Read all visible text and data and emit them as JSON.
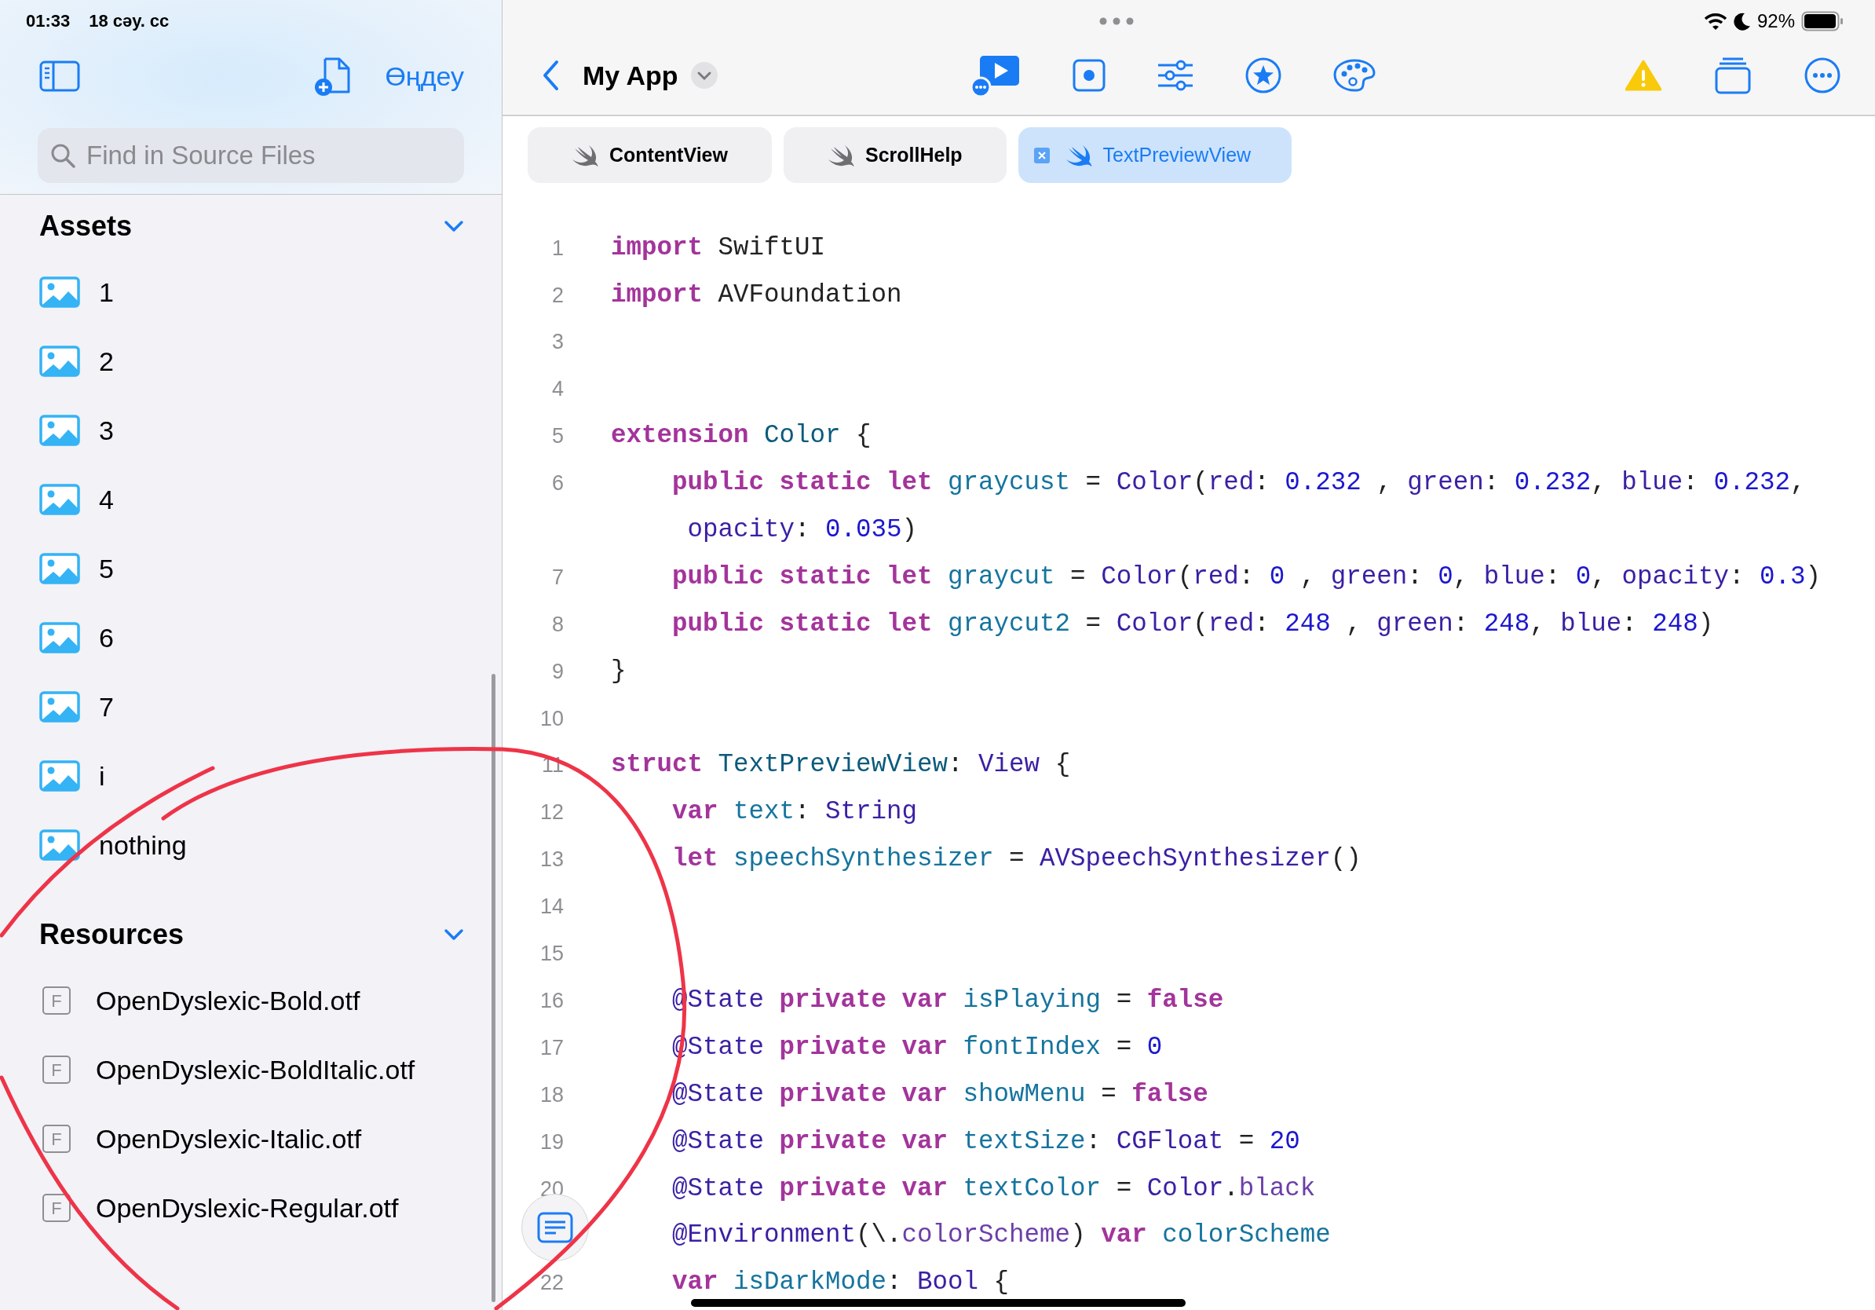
{
  "status_bar": {
    "time": "01:33",
    "date": "18 сәу. сс",
    "battery": "92%"
  },
  "sidebar": {
    "edit_button": "Өңдеу",
    "search": {
      "placeholder": "Find in Source Files"
    },
    "sections": [
      {
        "title": "Assets",
        "expanded": true,
        "items": [
          {
            "kind": "image",
            "label": "1"
          },
          {
            "kind": "image",
            "label": "2"
          },
          {
            "kind": "image",
            "label": "3"
          },
          {
            "kind": "image",
            "label": "4"
          },
          {
            "kind": "image",
            "label": "5"
          },
          {
            "kind": "image",
            "label": "6"
          },
          {
            "kind": "image",
            "label": "7"
          },
          {
            "kind": "image",
            "label": "i"
          },
          {
            "kind": "image",
            "label": "nothing"
          }
        ]
      },
      {
        "title": "Resources",
        "expanded": true,
        "items": [
          {
            "kind": "font",
            "label": "OpenDyslexic-Bold.otf",
            "badge": "F"
          },
          {
            "kind": "font",
            "label": "OpenDyslexic-BoldItalic.otf",
            "badge": "F"
          },
          {
            "kind": "font",
            "label": "OpenDyslexic-Italic.otf",
            "badge": "F"
          },
          {
            "kind": "font",
            "label": "OpenDyslexic-Regular.otf",
            "badge": "F"
          }
        ]
      }
    ]
  },
  "toolbar": {
    "title": "My App"
  },
  "tabs": [
    {
      "label": "ContentView",
      "selected": false
    },
    {
      "label": "ScrollHelp",
      "selected": false
    },
    {
      "label": "TextPreviewView",
      "selected": true
    }
  ],
  "code": {
    "lines": [
      {
        "number": "1",
        "tokens": [
          {
            "kind": "kw",
            "text": "import"
          },
          {
            "kind": "pl",
            "text": " SwiftUI"
          }
        ]
      },
      {
        "number": "2",
        "tokens": [
          {
            "kind": "kw",
            "text": "import"
          },
          {
            "kind": "pl",
            "text": " AVFoundation"
          }
        ]
      },
      {
        "number": "3"
      },
      {
        "number": "4"
      },
      {
        "number": "5",
        "tokens": [
          {
            "kind": "kw",
            "text": "extension"
          },
          {
            "kind": "decl",
            "text": " Color"
          },
          {
            "kind": "pl",
            "text": " {"
          }
        ]
      },
      {
        "number": "6",
        "tokens": [
          {
            "kind": "kw",
            "text": "    public static let"
          },
          {
            "kind": "id",
            "text": " graycust"
          },
          {
            "kind": "pl",
            "text": " = "
          },
          {
            "kind": "type",
            "text": "Color"
          },
          {
            "kind": "pl",
            "text": "("
          },
          {
            "kind": "type",
            "text": "red"
          },
          {
            "kind": "pl",
            "text": ": "
          },
          {
            "kind": "num",
            "text": "0.232"
          },
          {
            "kind": "pl",
            "text": " , "
          },
          {
            "kind": "type",
            "text": "green"
          },
          {
            "kind": "pl",
            "text": ": "
          },
          {
            "kind": "num",
            "text": "0.232"
          },
          {
            "kind": "pl",
            "text": ", "
          },
          {
            "kind": "type",
            "text": "blue"
          },
          {
            "kind": "pl",
            "text": ": "
          },
          {
            "kind": "num",
            "text": "0.232"
          },
          {
            "kind": "pl",
            "text": ","
          }
        ]
      },
      {
        "tokens": [
          {
            "kind": "type",
            "text": "     opacity"
          },
          {
            "kind": "pl",
            "text": ": "
          },
          {
            "kind": "num",
            "text": "0.035"
          },
          {
            "kind": "pl",
            "text": ")"
          }
        ]
      },
      {
        "number": "7",
        "tokens": [
          {
            "kind": "kw",
            "text": "    public static let"
          },
          {
            "kind": "id",
            "text": " graycut"
          },
          {
            "kind": "pl",
            "text": " = "
          },
          {
            "kind": "type",
            "text": "Color"
          },
          {
            "kind": "pl",
            "text": "("
          },
          {
            "kind": "type",
            "text": "red"
          },
          {
            "kind": "pl",
            "text": ": "
          },
          {
            "kind": "num",
            "text": "0"
          },
          {
            "kind": "pl",
            "text": " , "
          },
          {
            "kind": "type",
            "text": "green"
          },
          {
            "kind": "pl",
            "text": ": "
          },
          {
            "kind": "num",
            "text": "0"
          },
          {
            "kind": "pl",
            "text": ", "
          },
          {
            "kind": "type",
            "text": "blue"
          },
          {
            "kind": "pl",
            "text": ": "
          },
          {
            "kind": "num",
            "text": "0"
          },
          {
            "kind": "pl",
            "text": ", "
          },
          {
            "kind": "type",
            "text": "opacity"
          },
          {
            "kind": "pl",
            "text": ": "
          },
          {
            "kind": "num",
            "text": "0.3"
          },
          {
            "kind": "pl",
            "text": ")"
          }
        ]
      },
      {
        "number": "8",
        "tokens": [
          {
            "kind": "kw",
            "text": "    public static let"
          },
          {
            "kind": "id",
            "text": " graycut2"
          },
          {
            "kind": "pl",
            "text": " = "
          },
          {
            "kind": "type",
            "text": "Color"
          },
          {
            "kind": "pl",
            "text": "("
          },
          {
            "kind": "type",
            "text": "red"
          },
          {
            "kind": "pl",
            "text": ": "
          },
          {
            "kind": "num",
            "text": "248"
          },
          {
            "kind": "pl",
            "text": " , "
          },
          {
            "kind": "type",
            "text": "green"
          },
          {
            "kind": "pl",
            "text": ": "
          },
          {
            "kind": "num",
            "text": "248"
          },
          {
            "kind": "pl",
            "text": ", "
          },
          {
            "kind": "type",
            "text": "blue"
          },
          {
            "kind": "pl",
            "text": ": "
          },
          {
            "kind": "num",
            "text": "248"
          },
          {
            "kind": "pl",
            "text": ")"
          }
        ]
      },
      {
        "number": "9",
        "tokens": [
          {
            "kind": "pl",
            "text": "}"
          }
        ]
      },
      {
        "number": "10"
      },
      {
        "number": "11",
        "tokens": [
          {
            "kind": "kw",
            "text": "struct"
          },
          {
            "kind": "decl",
            "text": " TextPreviewView"
          },
          {
            "kind": "pl",
            "text": ": "
          },
          {
            "kind": "type",
            "text": "View"
          },
          {
            "kind": "pl",
            "text": " {"
          }
        ]
      },
      {
        "number": "12",
        "tokens": [
          {
            "kind": "kw",
            "text": "    var"
          },
          {
            "kind": "id",
            "text": " text"
          },
          {
            "kind": "pl",
            "text": ": "
          },
          {
            "kind": "type",
            "text": "String"
          }
        ]
      },
      {
        "number": "13",
        "tokens": [
          {
            "kind": "kw",
            "text": "    let"
          },
          {
            "kind": "id",
            "text": " speechSynthesizer"
          },
          {
            "kind": "pl",
            "text": " = "
          },
          {
            "kind": "type",
            "text": "AVSpeechSynthesizer"
          },
          {
            "kind": "pl",
            "text": "()"
          }
        ]
      },
      {
        "number": "14"
      },
      {
        "number": "15"
      },
      {
        "number": "16",
        "tokens": [
          {
            "kind": "type",
            "text": "    @State"
          },
          {
            "kind": "kw",
            "text": " private var"
          },
          {
            "kind": "id",
            "text": " isPlaying"
          },
          {
            "kind": "pl",
            "text": " = "
          },
          {
            "kind": "kw",
            "text": "false"
          }
        ]
      },
      {
        "number": "17",
        "tokens": [
          {
            "kind": "type",
            "text": "    @State"
          },
          {
            "kind": "kw",
            "text": " private var"
          },
          {
            "kind": "id",
            "text": " fontIndex"
          },
          {
            "kind": "pl",
            "text": " = "
          },
          {
            "kind": "num",
            "text": "0"
          }
        ]
      },
      {
        "number": "18",
        "tokens": [
          {
            "kind": "type",
            "text": "    @State"
          },
          {
            "kind": "kw",
            "text": " private var"
          },
          {
            "kind": "id",
            "text": " showMenu"
          },
          {
            "kind": "pl",
            "text": " = "
          },
          {
            "kind": "kw",
            "text": "false"
          }
        ]
      },
      {
        "number": "19",
        "tokens": [
          {
            "kind": "type",
            "text": "    @State"
          },
          {
            "kind": "kw",
            "text": " private var"
          },
          {
            "kind": "id",
            "text": " textSize"
          },
          {
            "kind": "pl",
            "text": ": "
          },
          {
            "kind": "type",
            "text": "CGFloat"
          },
          {
            "kind": "pl",
            "text": " = "
          },
          {
            "kind": "num",
            "text": "20"
          }
        ]
      },
      {
        "number": "20",
        "tokens": [
          {
            "kind": "type",
            "text": "    @State"
          },
          {
            "kind": "kw",
            "text": " private var"
          },
          {
            "kind": "id",
            "text": " textColor"
          },
          {
            "kind": "pl",
            "text": " = "
          },
          {
            "kind": "type",
            "text": "Color"
          },
          {
            "kind": "pl",
            "text": "."
          },
          {
            "kind": "mem",
            "text": "black"
          }
        ]
      },
      {
        "tokens": [
          {
            "kind": "type",
            "text": "    @Environment"
          },
          {
            "kind": "pl",
            "text": "(\\."
          },
          {
            "kind": "mem",
            "text": "colorScheme"
          },
          {
            "kind": "pl",
            "text": ") "
          },
          {
            "kind": "kw",
            "text": "var"
          },
          {
            "kind": "id",
            "text": " colorScheme"
          }
        ]
      },
      {
        "number": "22",
        "tokens": [
          {
            "kind": "kw",
            "text": "    var"
          },
          {
            "kind": "id",
            "text": " isDarkMode"
          },
          {
            "kind": "pl",
            "text": ": "
          },
          {
            "kind": "type",
            "text": "Bool"
          },
          {
            "kind": "pl",
            "text": " {"
          }
        ]
      }
    ]
  }
}
